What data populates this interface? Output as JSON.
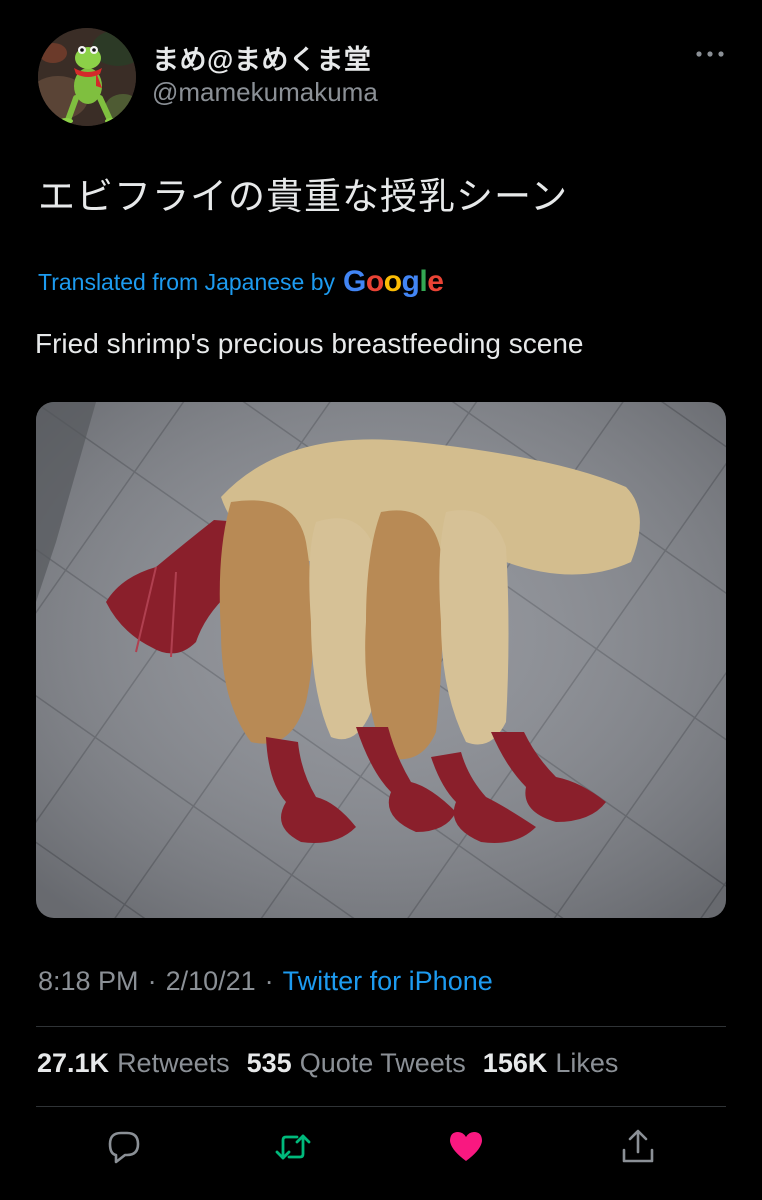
{
  "user": {
    "display_name": "まめ@まめくま堂",
    "handle": "@mamekumakuma"
  },
  "tweet": {
    "text": "エビフライの貴重な授乳シーン",
    "translated_label": "Translated from Japanese by",
    "translation_provider": "Google",
    "translation": "Fried shrimp's precious breastfeeding scene"
  },
  "meta": {
    "time": "8:18 PM",
    "separator": "·",
    "date": "2/10/21",
    "source": "Twitter for iPhone"
  },
  "stats": {
    "retweets_count": "27.1K",
    "retweets_label": "Retweets",
    "quotes_count": "535",
    "quotes_label": "Quote Tweets",
    "likes_count": "156K",
    "likes_label": "Likes"
  },
  "icons": {
    "more": "more-horizontal-icon",
    "reply": "reply-icon",
    "retweet": "retweet-icon",
    "like": "heart-icon",
    "share": "share-icon"
  },
  "colors": {
    "background": "#000000",
    "text_primary": "#e7e9ea",
    "text_secondary": "#8b9096",
    "link": "#1d9bf0",
    "retweet_green": "#00ba7c",
    "like_pink": "#f91880",
    "divider": "#2f3336"
  }
}
